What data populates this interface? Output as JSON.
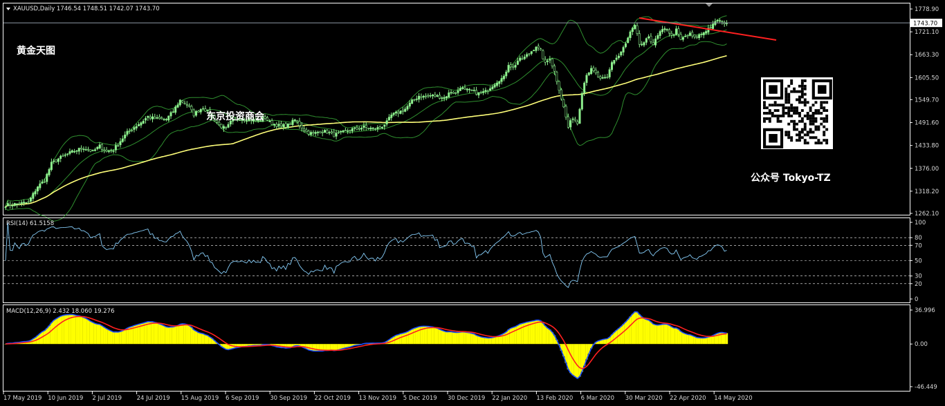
{
  "chart_data": {
    "type": "candlestick",
    "header": "XAUUSD,Daily  1746.54 1748.51 1742.07 1743.70",
    "y_ticks": [
      1778.9,
      1721.1,
      1663.3,
      1605.5,
      1549.7,
      1491.6,
      1433.8,
      1376.0,
      1318.2,
      1262.1
    ],
    "current_price": "1743.70",
    "ylim": [
      1262.1,
      1778.9
    ],
    "x_labels": [
      "17 May 2019",
      "10 Jun 2019",
      "2 Jul 2019",
      "24 Jul 2019",
      "15 Aug 2019",
      "6 Sep 2019",
      "30 Sep 2019",
      "22 Oct 2019",
      "13 Nov 2019",
      "5 Dec 2019",
      "30 Dec 2019",
      "22 Jan 2020",
      "13 Feb 2020",
      "6 Mar 2020",
      "30 Mar 2020",
      "22 Apr 2020",
      "14 May 2020"
    ],
    "close_keypoints": [
      [
        0,
        1283
      ],
      [
        5,
        1286
      ],
      [
        10,
        1290
      ],
      [
        14,
        1330
      ],
      [
        17,
        1345
      ],
      [
        20,
        1388
      ],
      [
        23,
        1400
      ],
      [
        27,
        1412
      ],
      [
        30,
        1420
      ],
      [
        34,
        1428
      ],
      [
        38,
        1418
      ],
      [
        41,
        1432
      ],
      [
        44,
        1418
      ],
      [
        47,
        1423
      ],
      [
        50,
        1445
      ],
      [
        53,
        1466
      ],
      [
        56,
        1480
      ],
      [
        59,
        1492
      ],
      [
        62,
        1507
      ],
      [
        64,
        1503
      ],
      [
        67,
        1500
      ],
      [
        70,
        1500
      ],
      [
        73,
        1520
      ],
      [
        76,
        1548
      ],
      [
        79,
        1538
      ],
      [
        82,
        1512
      ],
      [
        84,
        1522
      ],
      [
        86,
        1530
      ],
      [
        88,
        1518
      ],
      [
        90,
        1507
      ],
      [
        93,
        1485
      ],
      [
        96,
        1475
      ],
      [
        98,
        1492
      ],
      [
        102,
        1503
      ],
      [
        106,
        1500
      ],
      [
        110,
        1496
      ],
      [
        113,
        1505
      ],
      [
        115,
        1492
      ],
      [
        117,
        1488
      ],
      [
        120,
        1482
      ],
      [
        123,
        1485
      ],
      [
        126,
        1498
      ],
      [
        128,
        1486
      ],
      [
        131,
        1468
      ],
      [
        134,
        1463
      ],
      [
        137,
        1470
      ],
      [
        140,
        1468
      ],
      [
        143,
        1460
      ],
      [
        146,
        1465
      ],
      [
        150,
        1474
      ],
      [
        153,
        1476
      ],
      [
        156,
        1480
      ],
      [
        160,
        1476
      ],
      [
        163,
        1478
      ],
      [
        166,
        1492
      ],
      [
        168,
        1510
      ],
      [
        171,
        1517
      ],
      [
        174,
        1526
      ],
      [
        177,
        1545
      ],
      [
        180,
        1559
      ],
      [
        182,
        1557
      ],
      [
        185,
        1560
      ],
      [
        188,
        1558
      ],
      [
        191,
        1555
      ],
      [
        194,
        1570
      ],
      [
        196,
        1565
      ],
      [
        198,
        1582
      ],
      [
        200,
        1573
      ],
      [
        203,
        1572
      ],
      [
        206,
        1565
      ],
      [
        209,
        1570
      ],
      [
        212,
        1586
      ],
      [
        215,
        1600
      ],
      [
        217,
        1605
      ],
      [
        219,
        1640
      ],
      [
        221,
        1630
      ],
      [
        223,
        1648
      ],
      [
        226,
        1656
      ],
      [
        229,
        1672
      ],
      [
        231,
        1685
      ],
      [
        233,
        1671
      ],
      [
        235,
        1640
      ],
      [
        237,
        1655
      ],
      [
        239,
        1620
      ],
      [
        241,
        1577
      ],
      [
        243,
        1530
      ],
      [
        245,
        1480
      ],
      [
        247,
        1505
      ],
      [
        249,
        1490
      ],
      [
        251,
        1570
      ],
      [
        253,
        1615
      ],
      [
        255,
        1625
      ],
      [
        257,
        1615
      ],
      [
        259,
        1600
      ],
      [
        262,
        1605
      ],
      [
        264,
        1645
      ],
      [
        267,
        1660
      ],
      [
        270,
        1690
      ],
      [
        272,
        1719
      ],
      [
        274,
        1735
      ],
      [
        276,
        1690
      ],
      [
        278,
        1690
      ],
      [
        280,
        1710
      ],
      [
        282,
        1690
      ],
      [
        285,
        1720
      ],
      [
        288,
        1730
      ],
      [
        290,
        1710
      ],
      [
        292,
        1725
      ],
      [
        294,
        1700
      ],
      [
        296,
        1710
      ],
      [
        298,
        1715
      ],
      [
        300,
        1705
      ],
      [
        302,
        1712
      ],
      [
        304,
        1720
      ],
      [
        306,
        1730
      ],
      [
        308,
        1737
      ],
      [
        310,
        1752
      ],
      [
        312,
        1744
      ],
      [
        314,
        1745
      ]
    ],
    "rsi": {
      "label": "RSI(14) 61.5158",
      "levels": [
        80,
        70,
        50,
        30,
        20
      ],
      "y_ticks": [
        100,
        80,
        70,
        50,
        30,
        20,
        0
      ],
      "value": 61.5158
    },
    "macd": {
      "label": "MACD(12,26,9) 2.432 18.060 19.276",
      "y_ticks": [
        "36.996",
        "0.00",
        "-46.449"
      ],
      "ylim": [
        -46.449,
        36.996
      ]
    }
  },
  "overlay": {
    "title": "黄金天图",
    "company": "东京投资商会",
    "account": "公众号 Tokyo-TZ"
  },
  "colors": {
    "bull_candle": "#8ef08e",
    "bear_candle": "#000000",
    "bollinger": "#2f8f2f",
    "ma": "#ffff7a",
    "trendline": "#ff2020",
    "rsi_line": "#87cefa",
    "macd_fast": "#1a4dff",
    "macd_signal": "#ff2020",
    "macd_hist": "#ffff00",
    "grid": "#ffffff"
  },
  "icons": [
    "qr-code-icon",
    "dropdown-triangle-icon",
    "shift-marker-icon"
  ]
}
